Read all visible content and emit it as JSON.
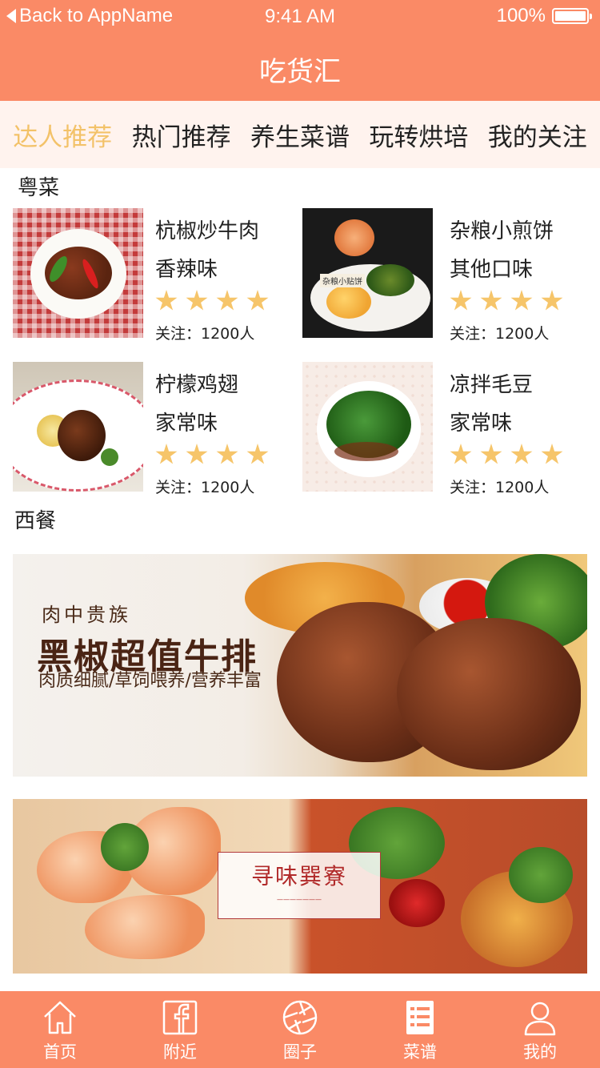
{
  "status_bar": {
    "back_text": "Back to AppName",
    "time": "9:41 AM",
    "battery_text": "100%",
    "battery_level": 1.0
  },
  "header": {
    "title": "吃货汇"
  },
  "category_tabs": [
    {
      "label": "达人推荐",
      "active": true
    },
    {
      "label": "热门推荐",
      "active": false
    },
    {
      "label": "养生菜谱",
      "active": false
    },
    {
      "label": "玩转烘培",
      "active": false
    },
    {
      "label": "我的关注",
      "active": false
    }
  ],
  "sections": {
    "cantonese": {
      "label": "粤菜"
    },
    "western": {
      "label": "西餐"
    }
  },
  "dishes": [
    {
      "name": "杭椒炒牛肉",
      "flavor": "香辣味",
      "rating": 4,
      "follow": "关注：1200人"
    },
    {
      "name": "杂粮小煎饼",
      "flavor": "其他口味",
      "rating": 4,
      "follow": "关注：1200人",
      "photo_caption": "杂粮小贴饼"
    },
    {
      "name": "柠檬鸡翅",
      "flavor": "家常味",
      "rating": 4,
      "follow": "关注：1200人"
    },
    {
      "name": "凉拌毛豆",
      "flavor": "家常味",
      "rating": 4,
      "follow": "关注：1200人"
    }
  ],
  "banners": [
    {
      "kicker": "肉中贵族",
      "title": "黑椒超值牛排",
      "subtitle": "肉质细腻/草饲喂养/营养丰富"
    },
    {
      "title": "寻味巽寮"
    }
  ],
  "tabbar": [
    {
      "label": "首页",
      "icon": "home-icon"
    },
    {
      "label": "附近",
      "icon": "facebook-icon"
    },
    {
      "label": "圈子",
      "icon": "aperture-icon"
    },
    {
      "label": "菜谱",
      "icon": "recipe-list-icon"
    },
    {
      "label": "我的",
      "icon": "user-icon"
    }
  ],
  "colors": {
    "brand": "#fa8a66",
    "active_tab": "#f3c269",
    "tab_bg": "#fff3ee",
    "star": "#f6c56a"
  }
}
